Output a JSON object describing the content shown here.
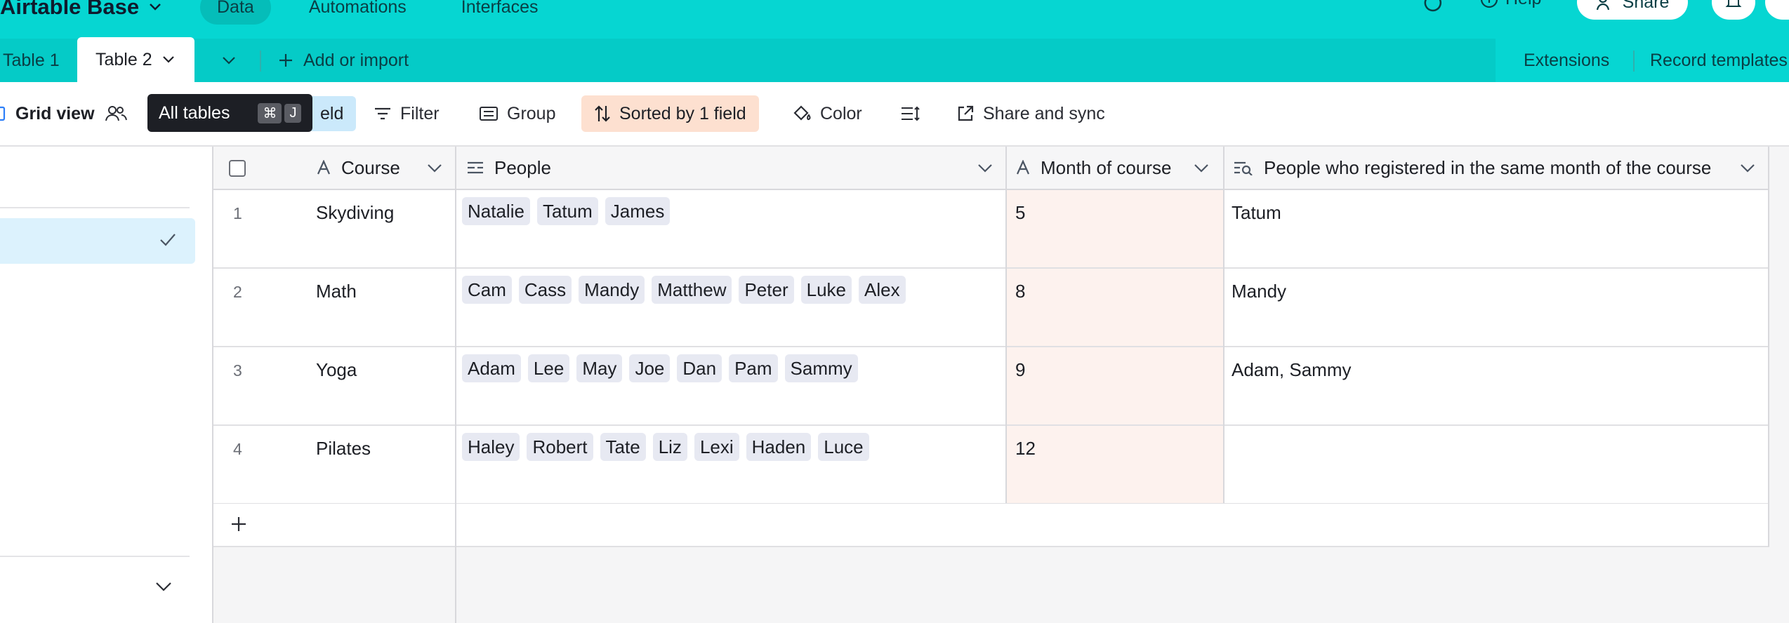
{
  "topbar": {
    "base_title": "Airtable Base",
    "nav": [
      {
        "label": "Data",
        "active": true
      },
      {
        "label": "Automations",
        "active": false
      },
      {
        "label": "Interfaces",
        "active": false
      }
    ],
    "help_label": "Help",
    "share_label": "Share",
    "bg_color": "#06d6d2"
  },
  "tabs": {
    "items": [
      {
        "label": "Table 1",
        "active": false
      },
      {
        "label": "Table 2",
        "active": true
      }
    ],
    "add_import_label": "Add or import",
    "extensions_label": "Extensions",
    "record_templates_label": "Record templates"
  },
  "toolbar": {
    "view_name": "Grid view",
    "hide_fields_partial": "eld",
    "tooltip_label": "All tables",
    "tooltip_keys": [
      "⌘",
      "J"
    ],
    "filter_label": "Filter",
    "group_label": "Group",
    "sort_label": "Sorted by 1 field",
    "color_label": "Color",
    "share_sync_label": "Share and sync"
  },
  "grid": {
    "columns": [
      {
        "label": "Course",
        "icon": "text-field-icon"
      },
      {
        "label": "People",
        "icon": "linked-record-icon"
      },
      {
        "label": "Month of course",
        "icon": "text-field-icon"
      },
      {
        "label": "People who registered in the same month of the course",
        "icon": "lookup-field-icon"
      }
    ],
    "rows": [
      {
        "num": "1",
        "course": "Skydiving",
        "people": [
          "Natalie",
          "Tatum",
          "James"
        ],
        "month": "5",
        "same_month": "Tatum"
      },
      {
        "num": "2",
        "course": "Math",
        "people": [
          "Cam",
          "Cass",
          "Mandy",
          "Matthew",
          "Peter",
          "Luke",
          "Alex"
        ],
        "month": "8",
        "same_month": "Mandy"
      },
      {
        "num": "3",
        "course": "Yoga",
        "people": [
          "Adam",
          "Lee",
          "May",
          "Joe",
          "Dan",
          "Pam",
          "Sammy"
        ],
        "month": "9",
        "same_month": "Adam, Sammy"
      },
      {
        "num": "4",
        "course": "Pilates",
        "people": [
          "Haley",
          "Robert",
          "Tate",
          "Liz",
          "Lexi",
          "Haden",
          "Luce"
        ],
        "month": "12",
        "same_month": ""
      }
    ],
    "sorted_column_highlight": "#fdf2ee",
    "pill_color": "#e7e9f2"
  }
}
